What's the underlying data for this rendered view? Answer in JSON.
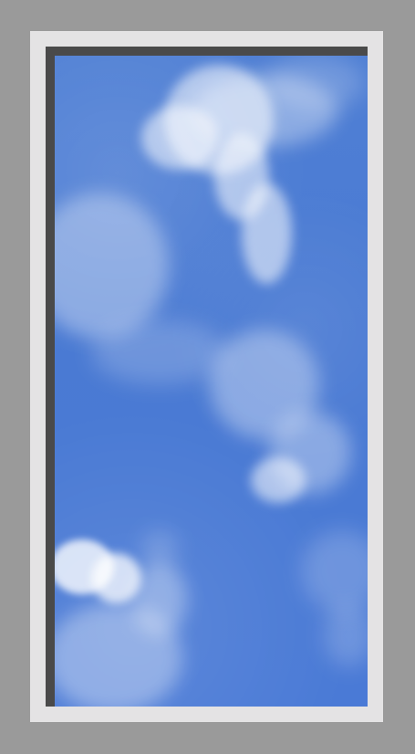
{
  "colors": {
    "background": "#9a9a9a",
    "outer_frame": "#e4e3e4",
    "inner_frame": "#4a4a4a",
    "sky": "#4a7ad4"
  }
}
